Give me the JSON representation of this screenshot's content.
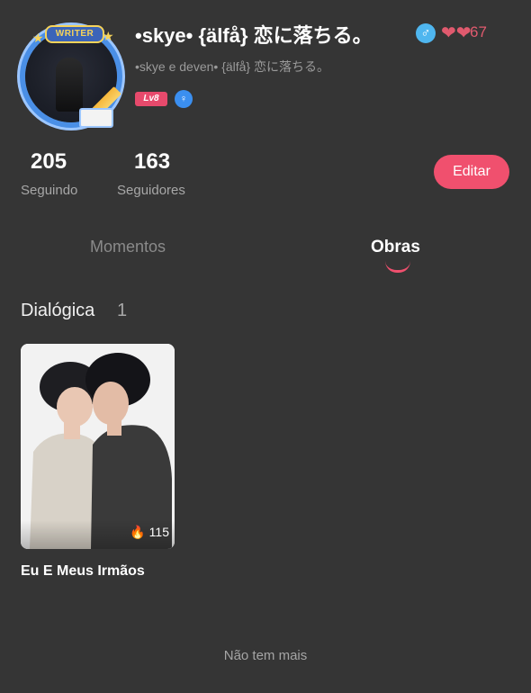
{
  "profile": {
    "badge_text": "WRITER",
    "name": "•skye• {älfå} 恋に落ちる。",
    "subtitle": "•skye e deven• {älfå} 恋に落ちる。",
    "hearts_count": "67",
    "level_text": "Lv8",
    "gender_icon_glyph": "♂",
    "hearts_glyph": "❤❤",
    "verified_glyph": "♀"
  },
  "stats": {
    "following_count": "205",
    "following_label": "Seguindo",
    "followers_count": "163",
    "followers_label": "Seguidores",
    "edit_label": "Editar"
  },
  "tabs": [
    {
      "label": "Momentos",
      "active": false
    },
    {
      "label": "Obras",
      "active": true
    }
  ],
  "section": {
    "title": "Dialógica",
    "count": "1"
  },
  "works": [
    {
      "title": "Eu E Meus Irmãos",
      "views": "115",
      "views_icon": "fire-icon"
    }
  ],
  "footer": {
    "text": "Não tem mais"
  },
  "colors": {
    "background": "#353535",
    "accent": "#f0506e",
    "gender": "#4fb6ef",
    "hearts": "#e05a6e"
  }
}
